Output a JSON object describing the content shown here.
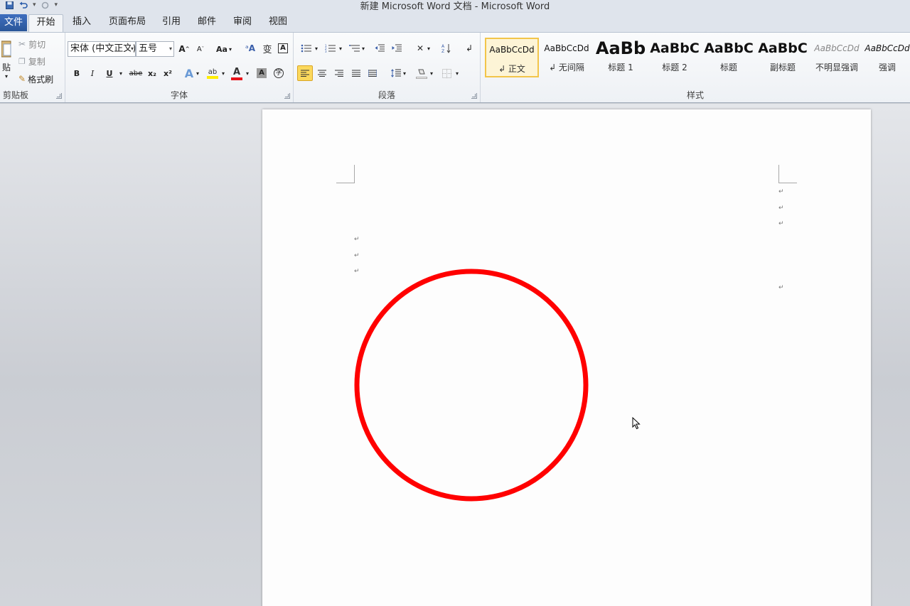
{
  "window": {
    "title": "新建 Microsoft Word 文档 - Microsoft Word"
  },
  "tabs": [
    {
      "label": "文件"
    },
    {
      "label": "开始"
    },
    {
      "label": "插入"
    },
    {
      "label": "页面布局"
    },
    {
      "label": "引用"
    },
    {
      "label": "邮件"
    },
    {
      "label": "审阅"
    },
    {
      "label": "视图"
    }
  ],
  "clipboard": {
    "paste": "贴",
    "cut": "剪切",
    "copy": "复制",
    "format_painter": "格式刷",
    "group_label": "剪贴板"
  },
  "font": {
    "family": "宋体 (中文正文)",
    "size": "五号",
    "change_case": "Aa",
    "bold": "B",
    "italic": "I",
    "underline": "U",
    "strike": "abe",
    "sub": "x₂",
    "sup": "x²",
    "group_label": "字体"
  },
  "paragraph": {
    "group_label": "段落"
  },
  "styles": {
    "group_label": "样式",
    "items": [
      {
        "preview": "AaBbCcDd",
        "label": "↲ 正文"
      },
      {
        "preview": "AaBbCcDd",
        "label": "↲ 无间隔"
      },
      {
        "preview": "AaBb",
        "label": "标题 1"
      },
      {
        "preview": "AaBbC",
        "label": "标题 2"
      },
      {
        "preview": "AaBbC",
        "label": "标题"
      },
      {
        "preview": "AaBbC",
        "label": "副标题"
      },
      {
        "preview": "AaBbCcDd",
        "label": "不明显强调"
      },
      {
        "preview": "AaBbCcDd",
        "label": "强调"
      }
    ]
  },
  "document": {
    "paragraph_mark": "↵",
    "shape_color": "#ff0000"
  }
}
